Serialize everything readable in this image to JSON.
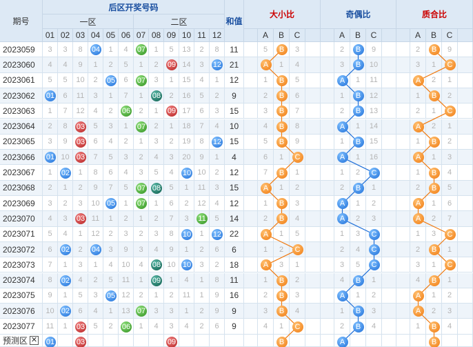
{
  "header": {
    "issue": "期号",
    "back_zone": "后区开奖号码",
    "zone1": "一区",
    "zone2": "二区",
    "sum": "和值",
    "big_small": "大小比",
    "odd_even": "奇偶比",
    "prime_comp": "质合比",
    "numbers": [
      "01",
      "02",
      "03",
      "04",
      "05",
      "06",
      "07",
      "08",
      "09",
      "10",
      "11",
      "12"
    ],
    "abc": [
      "A",
      "B",
      "C"
    ]
  },
  "colors": {
    "header_bg": "#dde9f5",
    "accent_blue": "#1f6fd8",
    "accent_orange": "#f07a10",
    "accent_red": "#cc0000"
  },
  "rows": [
    {
      "issue": "2023059",
      "cells": [
        "3",
        "3",
        "8",
        "04",
        "1",
        "4",
        "07",
        "1",
        "5",
        "13",
        "2",
        "8"
      ],
      "sum": "11",
      "bs": [
        "5",
        "B",
        "3"
      ],
      "oe": [
        "2",
        "B",
        "9"
      ],
      "pc": [
        "2",
        "B",
        "9"
      ]
    },
    {
      "issue": "2023060",
      "cells": [
        "4",
        "4",
        "9",
        "1",
        "2",
        "5",
        "1",
        "2",
        "09",
        "14",
        "3",
        "12"
      ],
      "sum": "21",
      "bs": [
        "A",
        "1",
        "4"
      ],
      "oe": [
        "3",
        "B",
        "10"
      ],
      "pc": [
        "3",
        "1",
        "C"
      ]
    },
    {
      "issue": "2023061",
      "cells": [
        "5",
        "5",
        "10",
        "2",
        "05",
        "6",
        "07",
        "3",
        "1",
        "15",
        "4",
        "1"
      ],
      "sum": "12",
      "bs": [
        "1",
        "B",
        "5"
      ],
      "oe": [
        "A",
        "1",
        "11"
      ],
      "pc": [
        "A",
        "2",
        "1"
      ]
    },
    {
      "issue": "2023062",
      "cells": [
        "01",
        "6",
        "11",
        "3",
        "1",
        "7",
        "1",
        "08",
        "2",
        "16",
        "5",
        "2"
      ],
      "sum": "9",
      "bs": [
        "2",
        "B",
        "6"
      ],
      "oe": [
        "1",
        "B",
        "12"
      ],
      "pc": [
        "1",
        "B",
        "2"
      ]
    },
    {
      "issue": "2023063",
      "cells": [
        "1",
        "7",
        "12",
        "4",
        "2",
        "06",
        "2",
        "1",
        "09",
        "17",
        "6",
        "3"
      ],
      "sum": "15",
      "bs": [
        "3",
        "B",
        "7"
      ],
      "oe": [
        "2",
        "B",
        "13"
      ],
      "pc": [
        "2",
        "1",
        "C"
      ]
    },
    {
      "issue": "2023064",
      "cells": [
        "2",
        "8",
        "03",
        "5",
        "3",
        "1",
        "07",
        "2",
        "1",
        "18",
        "7",
        "4"
      ],
      "sum": "10",
      "bs": [
        "4",
        "B",
        "8"
      ],
      "oe": [
        "A",
        "1",
        "14"
      ],
      "pc": [
        "A",
        "2",
        "1"
      ]
    },
    {
      "issue": "2023065",
      "cells": [
        "3",
        "9",
        "03",
        "6",
        "4",
        "2",
        "1",
        "3",
        "2",
        "19",
        "8",
        "12"
      ],
      "sum": "15",
      "bs": [
        "5",
        "B",
        "9"
      ],
      "oe": [
        "1",
        "B",
        "15"
      ],
      "pc": [
        "1",
        "B",
        "2"
      ]
    },
    {
      "issue": "2023066",
      "cells": [
        "01",
        "10",
        "03",
        "7",
        "5",
        "3",
        "2",
        "4",
        "3",
        "20",
        "9",
        "1"
      ],
      "sum": "4",
      "bs": [
        "6",
        "1",
        "C"
      ],
      "oe": [
        "A",
        "1",
        "16"
      ],
      "pc": [
        "A",
        "1",
        "3"
      ]
    },
    {
      "issue": "2023067",
      "cells": [
        "1",
        "02",
        "1",
        "8",
        "6",
        "4",
        "3",
        "5",
        "4",
        "10",
        "10",
        "2"
      ],
      "sum": "12",
      "bs": [
        "7",
        "B",
        "1"
      ],
      "oe": [
        "1",
        "2",
        "C"
      ],
      "pc": [
        "1",
        "B",
        "4"
      ]
    },
    {
      "issue": "2023068",
      "cells": [
        "2",
        "1",
        "2",
        "9",
        "7",
        "5",
        "07",
        "08",
        "5",
        "1",
        "11",
        "3"
      ],
      "sum": "15",
      "bs": [
        "A",
        "1",
        "2"
      ],
      "oe": [
        "2",
        "B",
        "1"
      ],
      "pc": [
        "2",
        "B",
        "5"
      ]
    },
    {
      "issue": "2023069",
      "cells": [
        "3",
        "2",
        "3",
        "10",
        "05",
        "1",
        "07",
        "1",
        "6",
        "2",
        "12",
        "4"
      ],
      "sum": "12",
      "bs": [
        "1",
        "B",
        "3"
      ],
      "oe": [
        "A",
        "1",
        "2"
      ],
      "pc": [
        "A",
        "1",
        "6"
      ]
    },
    {
      "issue": "2023070",
      "cells": [
        "4",
        "3",
        "03",
        "11",
        "1",
        "2",
        "1",
        "2",
        "7",
        "3",
        "11",
        "5"
      ],
      "sum": "14",
      "bs": [
        "2",
        "B",
        "4"
      ],
      "oe": [
        "A",
        "2",
        "3"
      ],
      "pc": [
        "A",
        "2",
        "7"
      ]
    },
    {
      "issue": "2023071",
      "cells": [
        "5",
        "4",
        "1",
        "12",
        "2",
        "3",
        "2",
        "3",
        "8",
        "10",
        "1",
        "12"
      ],
      "sum": "22",
      "bs": [
        "A",
        "1",
        "5"
      ],
      "oe": [
        "1",
        "3",
        "C"
      ],
      "pc": [
        "1",
        "3",
        "C"
      ]
    },
    {
      "issue": "2023072",
      "cells": [
        "6",
        "02",
        "2",
        "04",
        "3",
        "9",
        "3",
        "4",
        "9",
        "1",
        "2",
        "6"
      ],
      "sum": "6",
      "bs": [
        "1",
        "2",
        "C"
      ],
      "oe": [
        "2",
        "4",
        "C"
      ],
      "pc": [
        "2",
        "B",
        "1"
      ]
    },
    {
      "issue": "2023073",
      "cells": [
        "7",
        "1",
        "3",
        "1",
        "4",
        "10",
        "4",
        "08",
        "10",
        "10",
        "3",
        "2"
      ],
      "sum": "18",
      "bs": [
        "A",
        "3",
        "1"
      ],
      "oe": [
        "3",
        "5",
        "C"
      ],
      "pc": [
        "3",
        "1",
        "C"
      ]
    },
    {
      "issue": "2023074",
      "cells": [
        "8",
        "02",
        "4",
        "2",
        "5",
        "11",
        "1",
        "09",
        "1",
        "4",
        "1",
        "8"
      ],
      "sum": "11",
      "bs": [
        "1",
        "B",
        "2"
      ],
      "oe": [
        "4",
        "B",
        "1"
      ],
      "pc": [
        "4",
        "B",
        "1"
      ]
    },
    {
      "issue": "2023075",
      "cells": [
        "9",
        "1",
        "5",
        "3",
        "05",
        "12",
        "2",
        "1",
        "2",
        "11",
        "1",
        "9"
      ],
      "sum": "16",
      "bs": [
        "2",
        "B",
        "3"
      ],
      "oe": [
        "A",
        "1",
        "2"
      ],
      "pc": [
        "A",
        "1",
        "2"
      ]
    },
    {
      "issue": "2023076",
      "cells": [
        "10",
        "02",
        "6",
        "4",
        "1",
        "13",
        "07",
        "3",
        "3",
        "1",
        "2",
        "9"
      ],
      "sum": "9",
      "bs": [
        "3",
        "B",
        "4"
      ],
      "oe": [
        "1",
        "B",
        "3"
      ],
      "pc": [
        "A",
        "2",
        "3"
      ]
    },
    {
      "issue": "2023077",
      "cells": [
        "11",
        "1",
        "03",
        "5",
        "2",
        "06",
        "1",
        "4",
        "3",
        "4",
        "2",
        "6"
      ],
      "sum": "9",
      "bs": [
        "4",
        "1",
        "C"
      ],
      "oe": [
        "2",
        "B",
        "4"
      ],
      "pc": [
        "1",
        "B",
        "4"
      ]
    }
  ],
  "predict": {
    "label": "预测区",
    "x": "✕",
    "balls": [
      "01",
      "",
      "03",
      "",
      "",
      "",
      "",
      "",
      "09",
      "",
      "",
      ""
    ],
    "bs": [
      "",
      "B",
      ""
    ],
    "oe": [
      "A",
      "",
      ""
    ],
    "pc": [
      "",
      "B",
      ""
    ]
  }
}
